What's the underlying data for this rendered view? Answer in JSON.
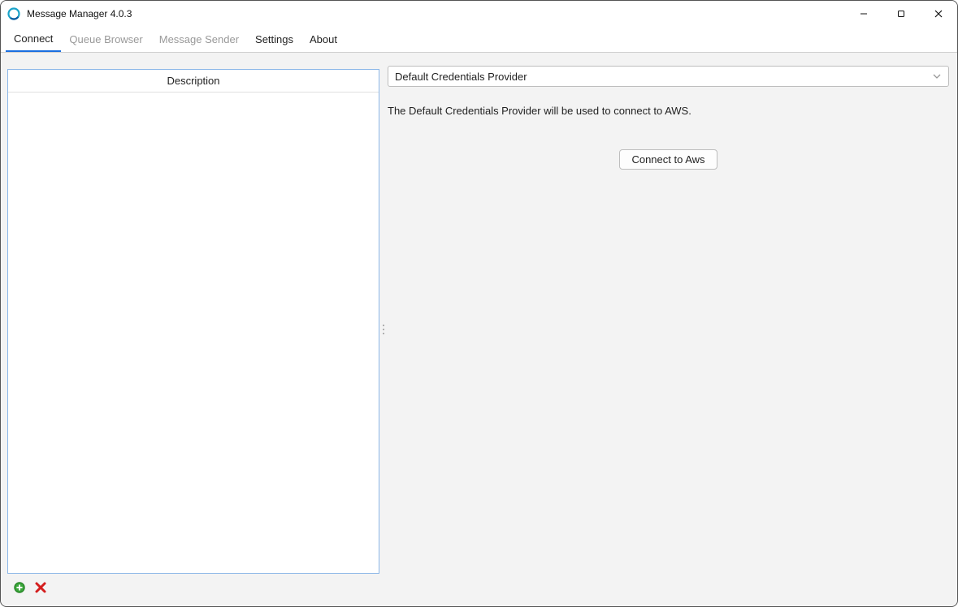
{
  "window": {
    "title": "Message Manager 4.0.3"
  },
  "tabs": [
    {
      "label": "Connect",
      "enabled": true,
      "active": true
    },
    {
      "label": "Queue Browser",
      "enabled": false,
      "active": false
    },
    {
      "label": "Message Sender",
      "enabled": false,
      "active": false
    },
    {
      "label": "Settings",
      "enabled": true,
      "active": false
    },
    {
      "label": "About",
      "enabled": true,
      "active": false
    }
  ],
  "left": {
    "column_header": "Description",
    "actions": {
      "add_icon": "plus-circle",
      "delete_icon": "x-red"
    }
  },
  "right": {
    "provider_selected": "Default Credentials Provider",
    "info_text": "The Default Credentials Provider will be used to connect to AWS.",
    "connect_button_label": "Connect to Aws"
  }
}
